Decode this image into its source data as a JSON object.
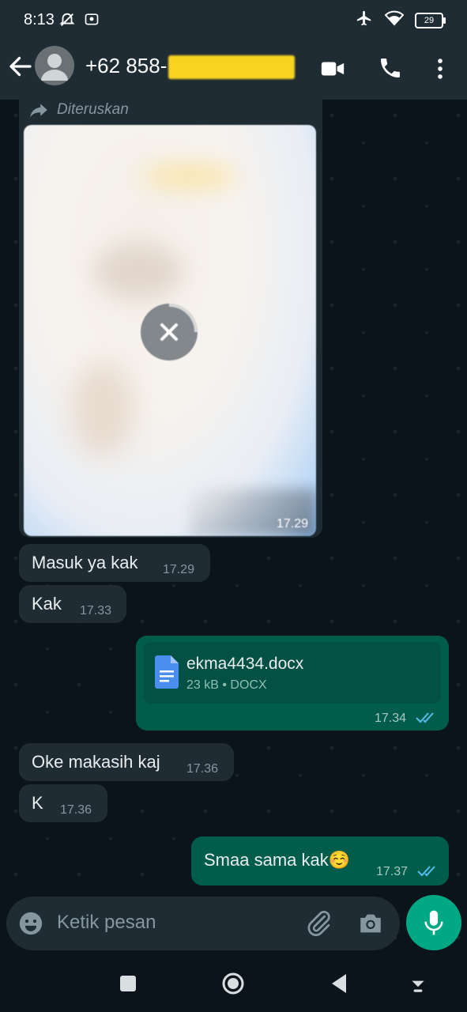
{
  "status_bar": {
    "time": "8:13",
    "battery": "29",
    "icons": [
      "mute-icon",
      "notification-icon",
      "airplane-icon",
      "wifi-icon",
      "battery-icon"
    ]
  },
  "header": {
    "contact_name": "+62 858-",
    "icons": [
      "back-arrow-icon",
      "avatar",
      "video-call-icon",
      "voice-call-icon",
      "more-vert-icon"
    ]
  },
  "messages": [
    {
      "type": "image",
      "direction": "incoming",
      "forwarded_label": "Diteruskan",
      "time": "17.29"
    },
    {
      "type": "text",
      "direction": "incoming",
      "text": "Masuk ya kak",
      "time": "17.29"
    },
    {
      "type": "text",
      "direction": "incoming",
      "text": "Kak",
      "time": "17.33"
    },
    {
      "type": "document",
      "direction": "outgoing",
      "file_name": "ekma4434.docx",
      "file_meta": "23 kB • DOCX",
      "time": "17.34",
      "status": "read"
    },
    {
      "type": "text",
      "direction": "incoming",
      "text": "Oke makasih kaj",
      "time": "17.36"
    },
    {
      "type": "text",
      "direction": "incoming",
      "text": "K",
      "time": "17.36"
    },
    {
      "type": "text",
      "direction": "outgoing",
      "text": "Smaa sama kak",
      "emoji": "☺️",
      "time": "17.37",
      "status": "read"
    }
  ],
  "composer": {
    "placeholder": "Ketik pesan",
    "icons": [
      "emoji-icon",
      "attach-icon",
      "camera-icon",
      "mic-icon"
    ]
  },
  "colors": {
    "header_bg": "#1f2c34",
    "chat_bg": "#0b141a",
    "incoming_bubble": "#202c33",
    "outgoing_bubble": "#005c4b",
    "accent": "#00a884",
    "read_tick": "#53bdeb"
  }
}
